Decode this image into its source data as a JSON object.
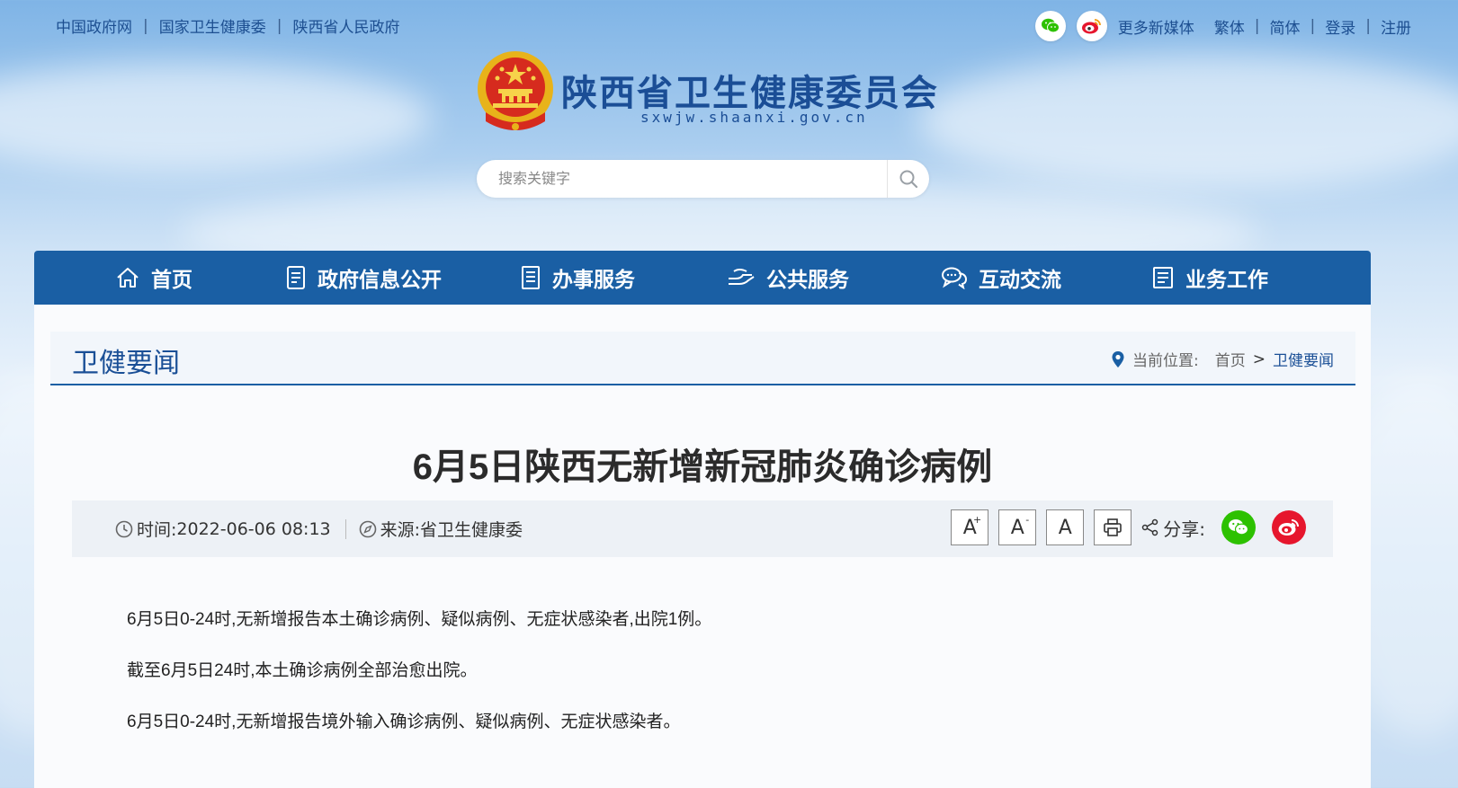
{
  "topbar": {
    "left_links": [
      "中国政府网",
      "国家卫生健康委",
      "陕西省人民政府"
    ],
    "more_media": "更多新媒体",
    "right_links": [
      "繁体",
      "简体",
      "登录",
      "注册"
    ]
  },
  "logo": {
    "title": "陕西省卫生健康委员会",
    "url": "sxwjw.shaanxi.gov.cn"
  },
  "search": {
    "placeholder": "搜索关键字",
    "icon": "search-icon"
  },
  "nav": [
    {
      "label": "首页",
      "icon": "home-icon"
    },
    {
      "label": "政府信息公开",
      "icon": "document-icon"
    },
    {
      "label": "办事服务",
      "icon": "clipboard-icon"
    },
    {
      "label": "公共服务",
      "icon": "hands-icon"
    },
    {
      "label": "互动交流",
      "icon": "chat-icon"
    },
    {
      "label": "业务工作",
      "icon": "briefcase-icon"
    }
  ],
  "section": {
    "title": "卫健要闻",
    "breadcrumb_label": "当前位置:",
    "breadcrumb_home": "首页",
    "breadcrumb_sep": ">",
    "breadcrumb_current": "卫健要闻"
  },
  "article": {
    "title": "6月5日陕西无新增新冠肺炎确诊病例",
    "time_label": "时间:",
    "time_value": "2022-06-06 08:13",
    "source_label": "来源:",
    "source_value": "省卫生健康委",
    "font_buttons": [
      "A",
      "A",
      "A"
    ],
    "share_label": "分享:",
    "paragraphs": [
      "6月5日0-24时,无新增报告本土确诊病例、疑似病例、无症状感染者,出院1例。",
      "截至6月5日24时,本土确诊病例全部治愈出院。",
      "6月5日0-24时,无新增报告境外输入确诊病例、疑似病例、无症状感染者。"
    ]
  },
  "colors": {
    "nav_bg": "#1a5fa4",
    "brand_blue": "#1b4e96",
    "wechat_green": "#2dc100",
    "weibo_red": "#e6162d"
  }
}
